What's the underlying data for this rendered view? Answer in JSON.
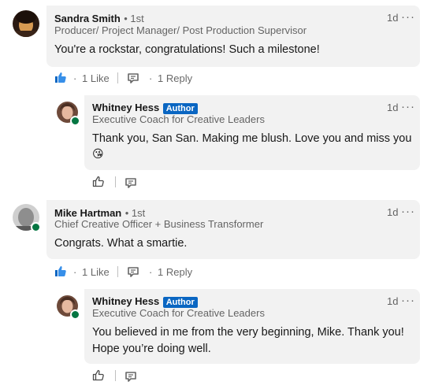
{
  "colors": {
    "bubble": "#f2f2f2",
    "author_badge": "#0a66c2",
    "like_blue": "#378fe9",
    "online": "#057642"
  },
  "comments": [
    {
      "name": "Sandra Smith",
      "degree": "• 1st",
      "headline": "Producer/ Project Manager/ Post Production Supervisor",
      "time": "1d",
      "text": "You're a rockstar, congratulations! Such a milestone!",
      "likes": "1 Like",
      "replies": "1 Reply",
      "dot": "·"
    },
    {
      "name": "Mike Hartman",
      "degree": "• 1st",
      "headline": "Chief Creative Officer + Business Transformer",
      "time": "1d",
      "text": "Congrats. What a smartie.",
      "likes": "1 Like",
      "replies": "1 Reply",
      "dot": "·"
    }
  ],
  "replies": [
    {
      "name": "Whitney Hess",
      "badge": "Author",
      "headline": "Executive Coach for Creative Leaders",
      "time": "1d",
      "text": "Thank you, San San. Making me blush. Love you and miss you",
      "emoji": "😘"
    },
    {
      "name": "Whitney Hess",
      "badge": "Author",
      "headline": "Executive Coach for Creative Leaders",
      "time": "1d",
      "text_line1": "You believed in me from the very beginning, Mike. Thank you!",
      "text_line2": "Hope you’re doing well."
    }
  ],
  "more_icon": "···",
  "icons": [
    "like-filled-icon",
    "reply-icon",
    "like-outline-icon",
    "more-options-icon"
  ]
}
